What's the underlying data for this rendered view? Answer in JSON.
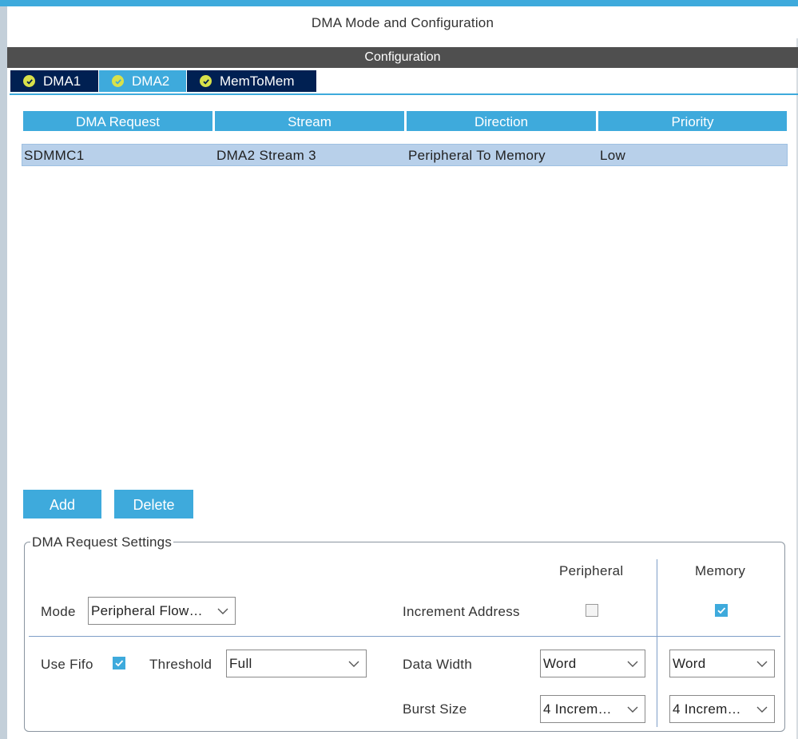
{
  "window": {
    "title": "DMA Mode and Configuration"
  },
  "config_bar": {
    "label": "Configuration"
  },
  "tabs": [
    {
      "label": "DMA1",
      "active": false,
      "icon": "check-circle-icon"
    },
    {
      "label": "DMA2",
      "active": true,
      "icon": "check-circle-icon"
    },
    {
      "label": "MemToMem",
      "active": false,
      "icon": "check-circle-icon"
    }
  ],
  "table": {
    "headers": [
      "DMA Request",
      "Stream",
      "Direction",
      "Priority"
    ],
    "rows": [
      [
        "SDMMC1",
        "DMA2 Stream 3",
        "Peripheral To Memory",
        "Low"
      ]
    ]
  },
  "buttons": {
    "add": "Add",
    "delete": "Delete"
  },
  "settings": {
    "title": "DMA Request Settings",
    "col_peripheral": "Peripheral",
    "col_memory": "Memory",
    "mode_label": "Mode",
    "mode_value": "Peripheral Flow…",
    "increment_label": "Increment Address",
    "increment_peripheral": false,
    "increment_memory": true,
    "use_fifo_label": "Use Fifo",
    "use_fifo": true,
    "threshold_label": "Threshold",
    "threshold_value": "Full",
    "data_width_label": "Data Width",
    "data_width_peripheral": "Word",
    "data_width_memory": "Word",
    "burst_label": "Burst Size",
    "burst_peripheral": "4 Increm…",
    "burst_memory": "4 Increm…"
  },
  "colors": {
    "accent": "#3eaadc",
    "tab_dark": "#002052",
    "selected_row": "#b8d0ea",
    "bar": "#4f4f4f"
  }
}
